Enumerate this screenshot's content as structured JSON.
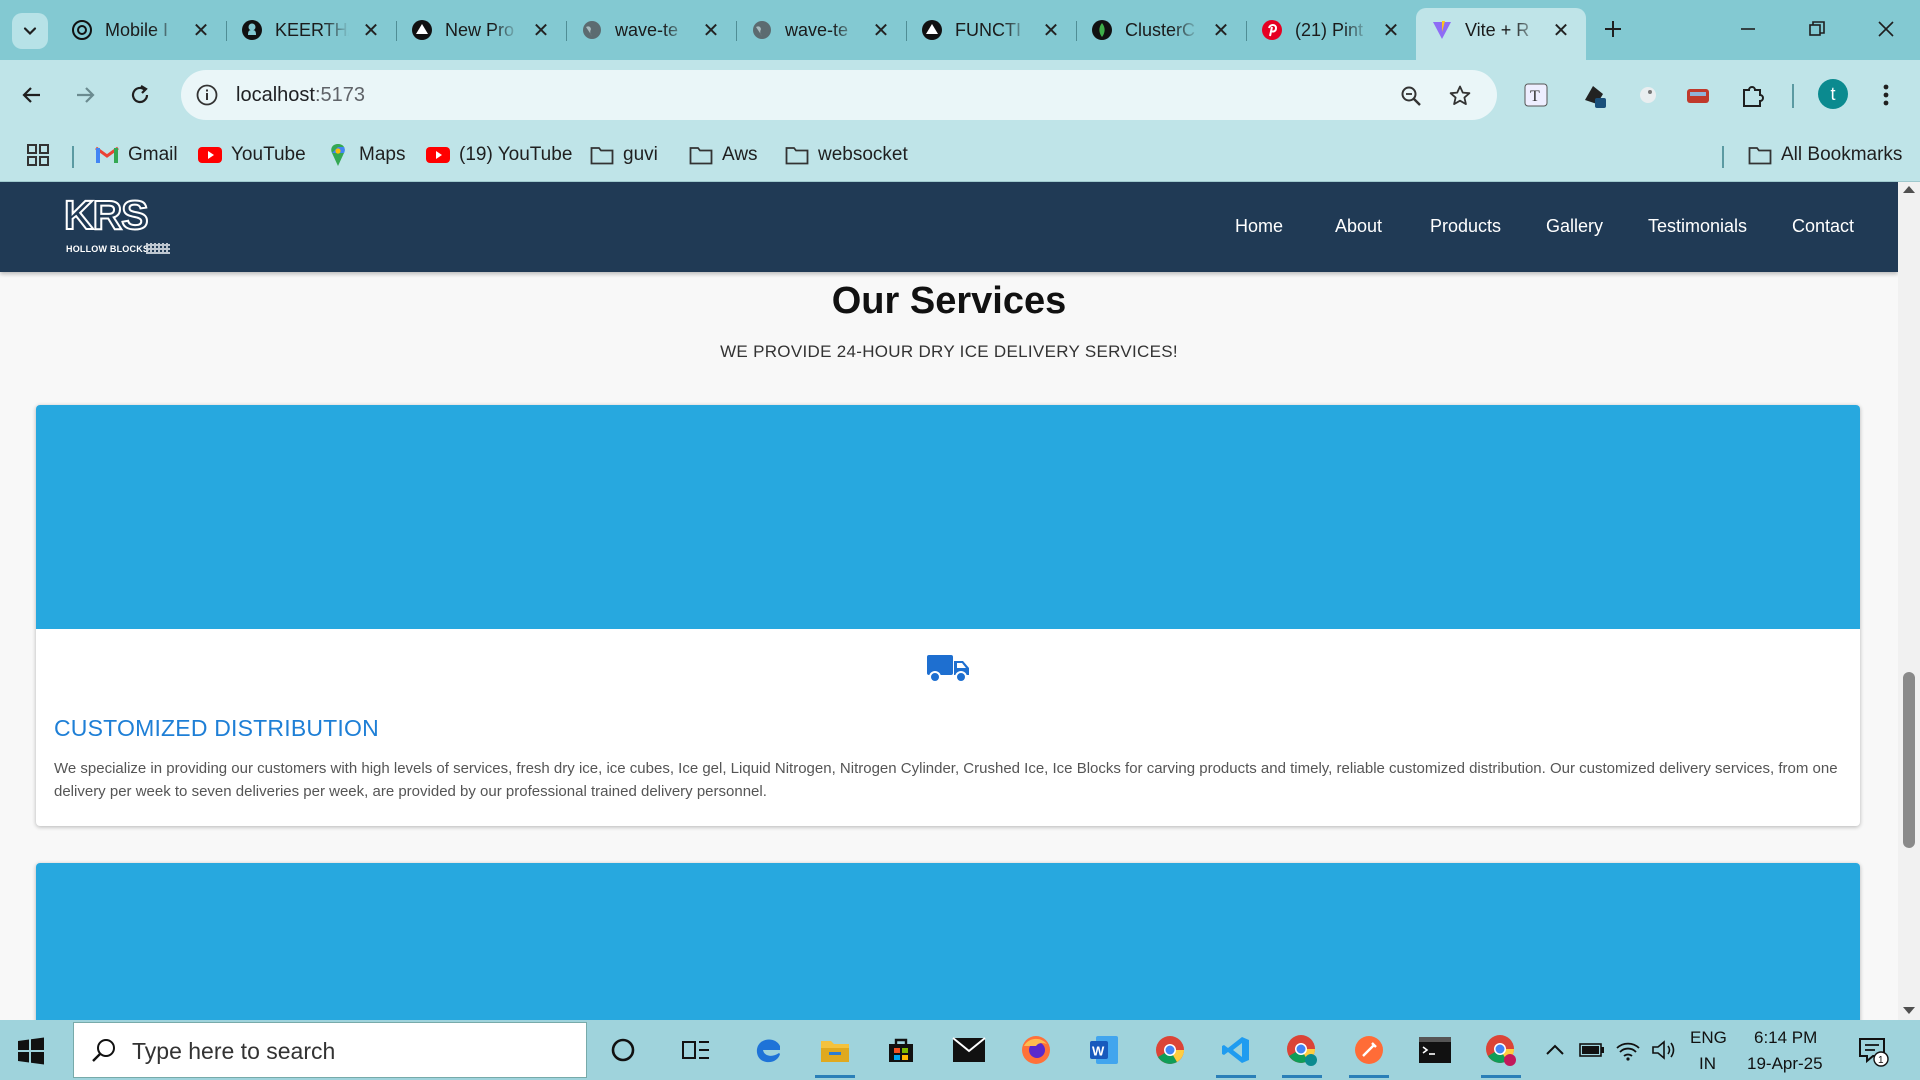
{
  "browser": {
    "tabs": [
      {
        "title": "Mobile I",
        "icon": "openai-icon"
      },
      {
        "title": "KEERTH/",
        "icon": "github-icon"
      },
      {
        "title": "New Pro",
        "icon": "vercel-icon"
      },
      {
        "title": "wave-te",
        "icon": "globe-icon"
      },
      {
        "title": "wave-te",
        "icon": "globe-icon"
      },
      {
        "title": "FUNCTI",
        "icon": "vercel-icon"
      },
      {
        "title": "ClusterC",
        "icon": "mongodb-icon"
      },
      {
        "title": "(21) Pint",
        "icon": "pinterest-icon"
      },
      {
        "title": "Vite + R",
        "icon": "vite-icon",
        "active": true
      }
    ],
    "url": {
      "host": "localhost",
      "port": ":5173"
    },
    "profile_initial": "t",
    "bookmarks": [
      {
        "label": "Gmail",
        "icon": "gmail-icon"
      },
      {
        "label": "YouTube",
        "icon": "youtube-icon"
      },
      {
        "label": "Maps",
        "icon": "maps-icon"
      },
      {
        "label": "(19) YouTube",
        "icon": "youtube-icon"
      },
      {
        "label": "guvi",
        "icon": "folder-icon"
      },
      {
        "label": "Aws",
        "icon": "folder-icon"
      },
      {
        "label": "websocket",
        "icon": "folder-icon"
      }
    ],
    "all_bookmarks": "All Bookmarks"
  },
  "site": {
    "logo": {
      "main": "KRS",
      "sub": "HOLLOW BLOCKS"
    },
    "nav": [
      "Home",
      "About",
      "Products",
      "Gallery",
      "Testimonials",
      "Contact"
    ],
    "services": {
      "title": "Our Services",
      "subtitle": "WE PROVIDE 24-HOUR DRY ICE DELIVERY SERVICES!",
      "cards": [
        {
          "icon": "truck-icon",
          "title": "CUSTOMIZED DISTRIBUTION",
          "text": "We specialize in providing our customers with high levels of services, fresh dry ice, ice cubes, Ice gel, Liquid Nitrogen, Nitrogen Cylinder, Crushed Ice, Ice Blocks for carving products and timely, reliable customized distribution. Our customized delivery services, from one delivery per week to seven deliveries per week, are provided by our professional trained delivery personnel."
        }
      ]
    },
    "colors": {
      "nav_bg": "#203a55",
      "banner": "#27a8df",
      "card_title": "#1e7fd6"
    }
  },
  "taskbar": {
    "search_placeholder": "Type here to search",
    "lang_line1": "ENG",
    "lang_line2": "IN",
    "time": "6:14 PM",
    "date": "19-Apr-25",
    "notification_count": "1"
  }
}
